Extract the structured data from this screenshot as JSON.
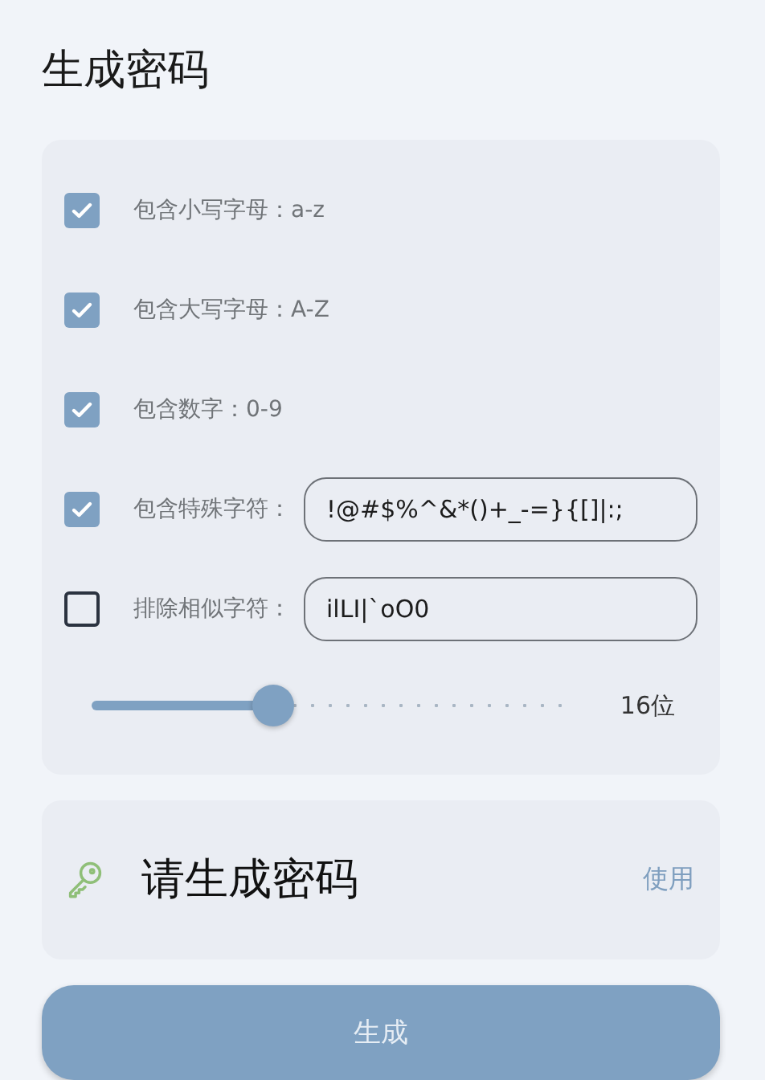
{
  "title": "生成密码",
  "options": [
    {
      "kind": "check",
      "label": "包含小写字母：a-z",
      "checked": true
    },
    {
      "kind": "check",
      "label": "包含大写字母：A-Z",
      "checked": true
    },
    {
      "kind": "check",
      "label": "包含数字：0-9",
      "checked": true
    },
    {
      "kind": "field",
      "label": "包含特殊字符：",
      "checked": true,
      "value": "!@#$%^&*()+_-=}{[]|:;"
    },
    {
      "kind": "field",
      "label": "排除相似字符：",
      "checked": false,
      "value": "ilLI|`oO0"
    }
  ],
  "length": {
    "level": 0.38,
    "reading": "16位"
  },
  "result": {
    "text": "请生成密码",
    "action": "使用"
  },
  "generate_button": "生成"
}
